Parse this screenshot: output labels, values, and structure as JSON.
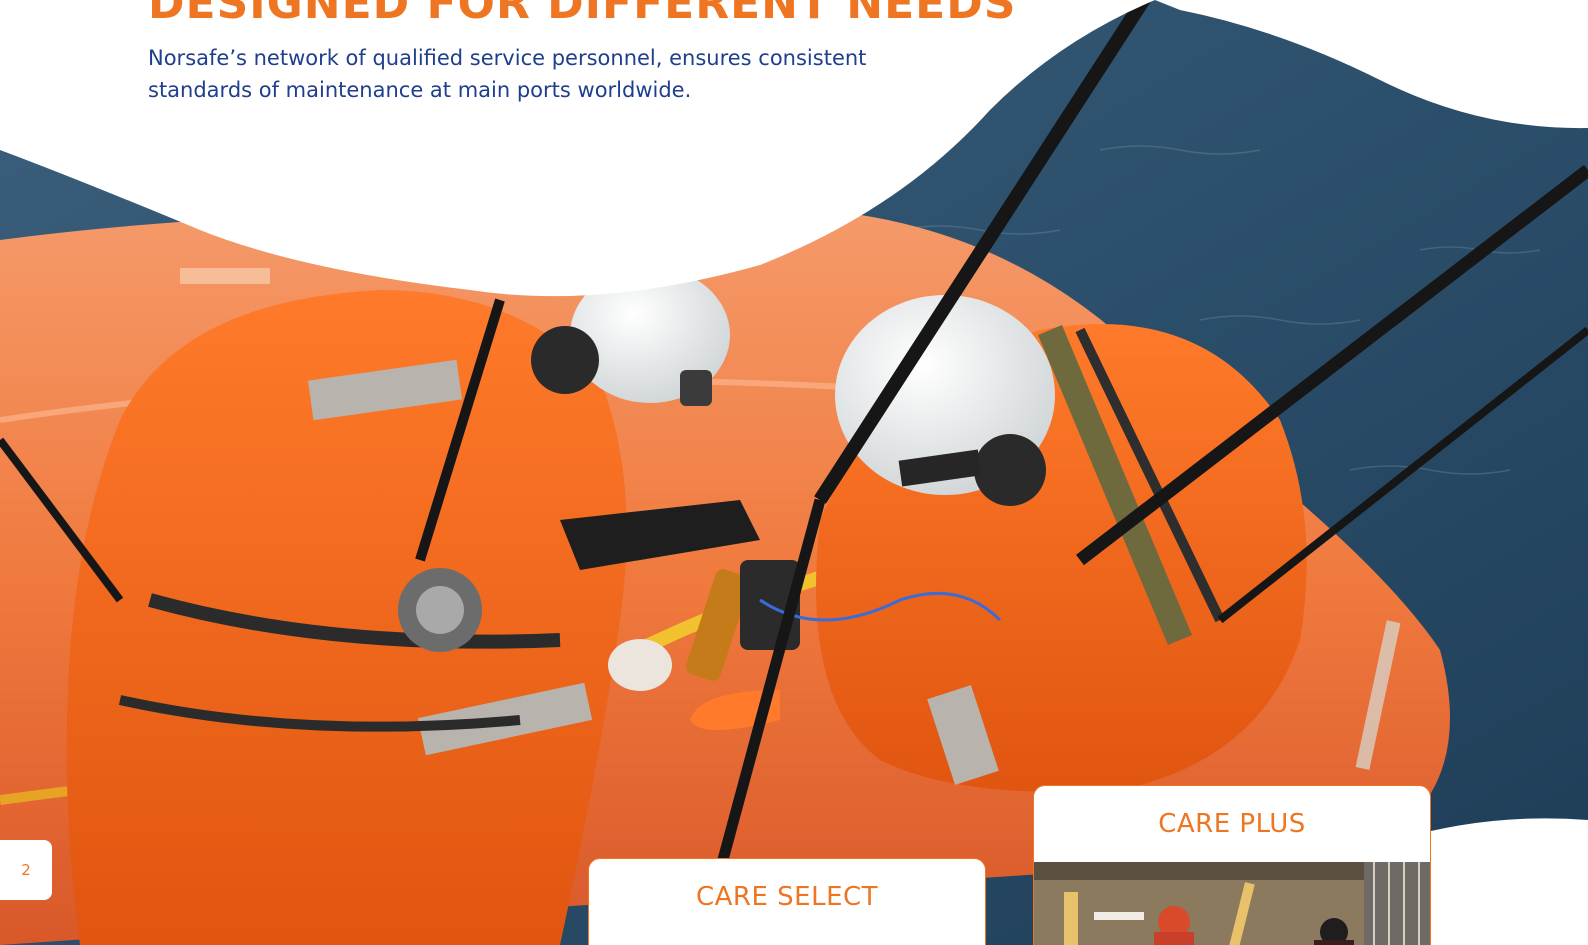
{
  "header": {
    "title": "DESIGNED FOR DIFFERENT NEEDS",
    "intro": "Norsafe’s network of qualified service personnel, ensures consistent standards of maintenance at main ports worldwide."
  },
  "page": {
    "number": "2"
  },
  "services": [
    {
      "title": "CARE SELECT"
    },
    {
      "title": "CARE PLUS"
    }
  ],
  "colors": {
    "accent": "#ee7623",
    "text_blue": "#1f3e8c",
    "sea": "#2c4f6b",
    "lifeboat_orange": "#f07a3e"
  },
  "images": {
    "hero": "photo-two-technicians-in-orange-suits-servicing-lifeboat-over-sea",
    "care_plus_thumb": "photo-crew-working-on-lifeboat-davit"
  }
}
